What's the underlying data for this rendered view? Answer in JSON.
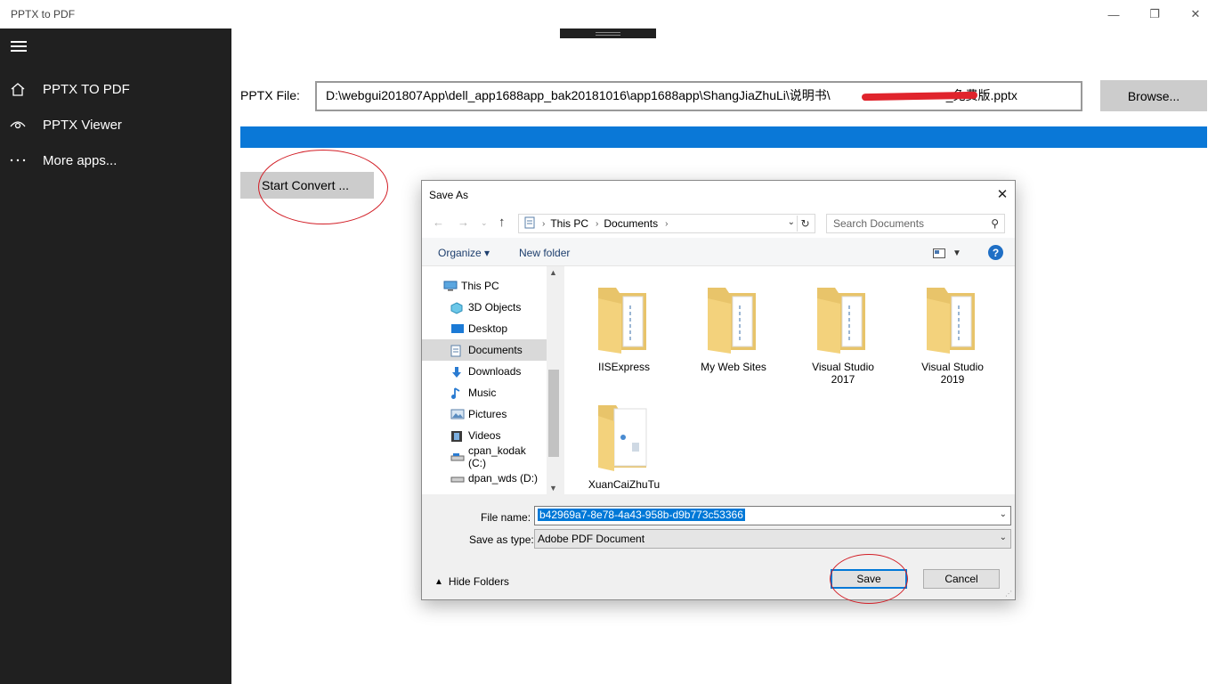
{
  "app": {
    "title": "PPTX to PDF",
    "window_controls": {
      "minimize": "—",
      "maximize": "❐",
      "close": "✕"
    }
  },
  "sidebar": {
    "items": [
      {
        "label": "PPTX TO PDF",
        "icon": "home-icon"
      },
      {
        "label": "PPTX Viewer",
        "icon": "eye-icon"
      },
      {
        "label": "More apps...",
        "icon": "more-dots-icon"
      }
    ]
  },
  "main": {
    "pptx_label": "PPTX File:",
    "pptx_path": "D:\\webgui201807App\\dell_app1688app_bak20181016\\app1688app\\ShangJiaZhuLi\\说明书\\",
    "pptx_path_suffix": "_免费版.pptx",
    "browse_label": "Browse...",
    "start_convert_label": "Start Convert ..."
  },
  "dialog": {
    "title": "Save As",
    "address": {
      "segment1": "This PC",
      "segment2": "Documents"
    },
    "search_placeholder": "Search Documents",
    "toolbar": {
      "organize": "Organize",
      "new_folder": "New folder"
    },
    "tree": [
      {
        "label": "This PC",
        "icon": "computer-icon"
      },
      {
        "label": "3D Objects",
        "icon": "cube-icon"
      },
      {
        "label": "Desktop",
        "icon": "desktop-icon"
      },
      {
        "label": "Documents",
        "icon": "document-icon",
        "selected": true
      },
      {
        "label": "Downloads",
        "icon": "download-icon"
      },
      {
        "label": "Music",
        "icon": "music-icon"
      },
      {
        "label": "Pictures",
        "icon": "picture-icon"
      },
      {
        "label": "Videos",
        "icon": "video-icon"
      },
      {
        "label": "cpan_kodak (C:)",
        "icon": "drive-icon"
      },
      {
        "label": "dpan_wds (D:)",
        "icon": "drive-icon"
      }
    ],
    "folders": [
      {
        "name": "IISExpress"
      },
      {
        "name": "My Web Sites"
      },
      {
        "name": "Visual Studio 2017"
      },
      {
        "name": "Visual Studio 2019"
      },
      {
        "name": "XuanCaiZhuTu"
      }
    ],
    "file_name_label": "File name:",
    "file_name_value": "b42969a7-8e78-4a43-958b-d9b773c53366",
    "save_as_type_label": "Save as type:",
    "save_as_type_value": "Adobe PDF Document",
    "hide_folders_label": "Hide Folders",
    "save_label": "Save",
    "cancel_label": "Cancel"
  },
  "colors": {
    "sidebar_bg": "#202020",
    "progress": "#0a78d7",
    "annotation": "#d21e26",
    "selection": "#0078d7"
  }
}
